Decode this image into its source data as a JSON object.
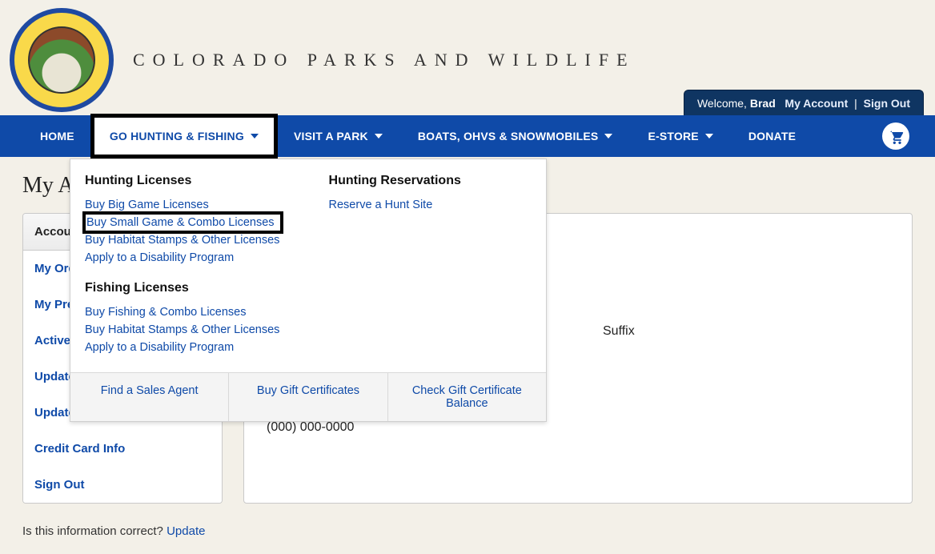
{
  "site_title": "COLORADO PARKS AND WILDLIFE",
  "user_bar": {
    "welcome_prefix": "Welcome, ",
    "name": "Brad",
    "my_account": "My Account",
    "sign_out": "Sign Out"
  },
  "nav": {
    "home": "HOME",
    "go_hunting": "GO HUNTING & FISHING",
    "visit_park": "VISIT A PARK",
    "boats": "BOATS, OHVS & SNOWMOBILES",
    "estore": "E-STORE",
    "donate": "DONATE"
  },
  "page_heading": "My Account",
  "sidebar": {
    "items": [
      "Account Information",
      "My Orders",
      "My Preference Points",
      "Active Applications",
      "Update Password",
      "Update Online Settings",
      "Credit Card Info",
      "Sign Out"
    ]
  },
  "account": {
    "suffix_label": "Suffix",
    "phone": "(000) 000-0000",
    "confirm_text": "Is this information correct? ",
    "update_link": "Update"
  },
  "mega": {
    "hunting_header": "Hunting Licenses",
    "hunting_links": [
      "Buy Big Game Licenses",
      "Buy Small Game & Combo Licenses",
      "Buy Habitat Stamps & Other Licenses",
      "Apply to a Disability Program"
    ],
    "fishing_header": "Fishing Licenses",
    "fishing_links": [
      "Buy Fishing & Combo Licenses",
      "Buy Habitat Stamps & Other Licenses",
      "Apply to a Disability Program"
    ],
    "reservations_header": "Hunting Reservations",
    "reservations_links": [
      "Reserve a Hunt Site"
    ],
    "footer": [
      "Find a Sales Agent",
      "Buy Gift Certificates",
      "Check Gift Certificate Balance"
    ]
  }
}
